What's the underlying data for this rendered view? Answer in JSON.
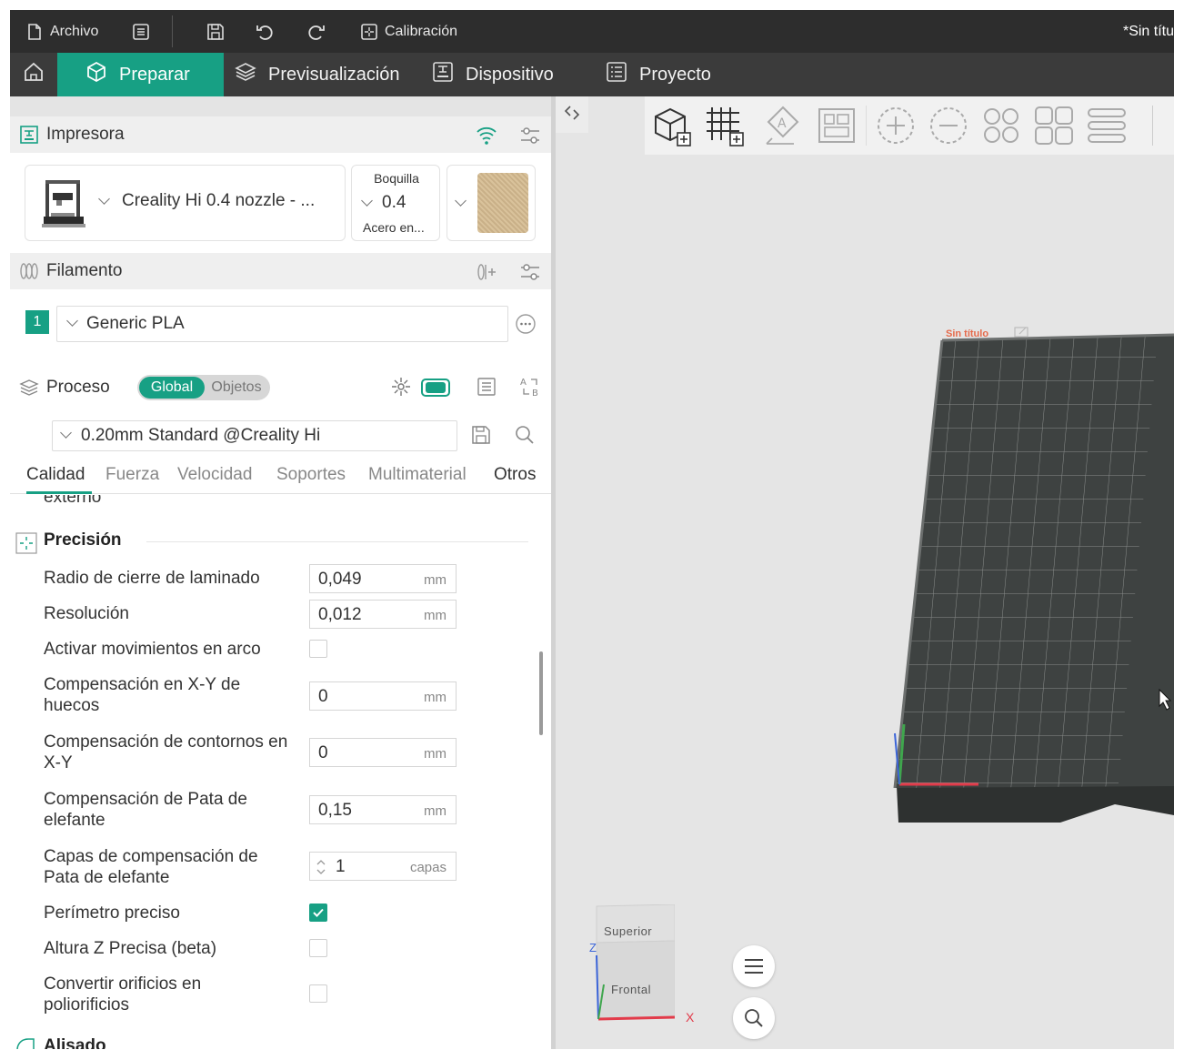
{
  "titlebar": {
    "file_label": "Archivo",
    "calibration_label": "Calibración",
    "document_title": "*Sin títu"
  },
  "nav": {
    "tabs": [
      {
        "label": "Preparar",
        "active": true
      },
      {
        "label": "Previsualización"
      },
      {
        "label": "Dispositivo"
      },
      {
        "label": "Proyecto"
      }
    ]
  },
  "printer": {
    "section_label": "Impresora",
    "selected_printer": "Creality Hi 0.4 nozzle - ...",
    "nozzle_label": "Boquilla",
    "nozzle_value": "0.4",
    "nozzle_material": "Acero en..."
  },
  "filament": {
    "section_label": "Filamento",
    "slot_number": "1",
    "selected": "Generic PLA"
  },
  "process": {
    "section_label": "Proceso",
    "scope_global": "Global",
    "scope_objects": "Objetos",
    "preset": "0.20mm Standard @Creality Hi",
    "tabs": [
      "Calidad",
      "Fuerza",
      "Velocidad",
      "Soportes",
      "Multimaterial",
      "Otros"
    ],
    "active_tab": "Calidad",
    "cut_previous_text": "externo",
    "group_precision": "Precisión",
    "group_next": "Alisado",
    "settings": [
      {
        "label": "Radio de cierre de laminado",
        "value": "0,049",
        "unit": "mm"
      },
      {
        "label": "Resolución",
        "value": "0,012",
        "unit": "mm"
      },
      {
        "label": "Activar movimientos en arco",
        "checked": false
      },
      {
        "label": "Compensación en X-Y de huecos",
        "value": "0",
        "unit": "mm"
      },
      {
        "label": "Compensación de contornos en X-Y",
        "value": "0",
        "unit": "mm"
      },
      {
        "label": "Compensación de Pata de elefante",
        "value": "0,15",
        "unit": "mm"
      },
      {
        "label": "Capas de compensación de Pata de elefante",
        "value": "1",
        "unit": "capas"
      },
      {
        "label": "Perímetro preciso",
        "checked": true
      },
      {
        "label": "Altura Z Precisa (beta)",
        "checked": false
      },
      {
        "label": "Convertir orificios en poliorificios",
        "checked": false
      }
    ]
  },
  "viewport": {
    "plate_label": "Sin título",
    "cube_top": "Superior",
    "cube_front": "Frontal",
    "axis_z": "Z",
    "axis_x": "X"
  },
  "colors": {
    "accent": "#17a084",
    "titlebar": "#2d2d2d",
    "navbar": "#3b3b3b",
    "plate": "#3e4241"
  }
}
